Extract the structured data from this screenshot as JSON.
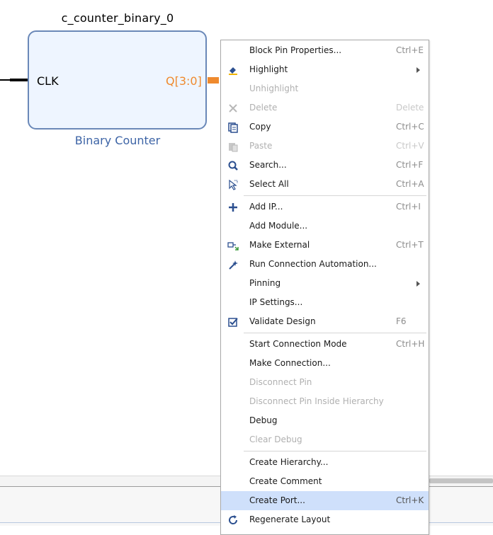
{
  "diagram": {
    "block_name": "c_counter_binary_0",
    "block_type": "Binary Counter",
    "input_pin": "CLK",
    "output_pin": "Q[3:0]",
    "colors": {
      "block_fill": "#eef5ff",
      "block_border": "#6a88b8",
      "output_pin": "#ef8a2e",
      "subtitle": "#3d64a6"
    }
  },
  "context_menu": {
    "items": [
      {
        "label": "Block Pin Properties...",
        "shortcut": "Ctrl+E",
        "icon": "",
        "disabled": false
      },
      {
        "label": "Highlight",
        "shortcut": "",
        "icon": "highlight-icon",
        "disabled": false,
        "submenu": true
      },
      {
        "label": "Unhighlight",
        "shortcut": "",
        "icon": "",
        "disabled": true
      },
      {
        "label": "Delete",
        "shortcut": "Delete",
        "icon": "delete-icon",
        "disabled": true
      },
      {
        "label": "Copy",
        "shortcut": "Ctrl+C",
        "icon": "copy-icon",
        "disabled": false
      },
      {
        "label": "Paste",
        "shortcut": "Ctrl+V",
        "icon": "paste-icon",
        "disabled": true
      },
      {
        "label": "Search...",
        "shortcut": "Ctrl+F",
        "icon": "search-icon",
        "disabled": false
      },
      {
        "label": "Select All",
        "shortcut": "Ctrl+A",
        "icon": "select-all-icon",
        "disabled": false
      },
      {
        "label": "Add IP...",
        "shortcut": "Ctrl+I",
        "icon": "add-icon",
        "disabled": false
      },
      {
        "label": "Add Module...",
        "shortcut": "",
        "icon": "",
        "disabled": false
      },
      {
        "label": "Make External",
        "shortcut": "Ctrl+T",
        "icon": "make-external-icon",
        "disabled": false
      },
      {
        "label": "Run Connection Automation...",
        "shortcut": "",
        "icon": "wand-icon",
        "disabled": false
      },
      {
        "label": "Pinning",
        "shortcut": "",
        "icon": "",
        "disabled": false,
        "submenu": true
      },
      {
        "label": "IP Settings...",
        "shortcut": "",
        "icon": "",
        "disabled": false
      },
      {
        "label": "Validate Design",
        "shortcut": "F6",
        "icon": "validate-icon",
        "disabled": false
      },
      {
        "label": "Start Connection Mode",
        "shortcut": "Ctrl+H",
        "icon": "",
        "disabled": false
      },
      {
        "label": "Make Connection...",
        "shortcut": "",
        "icon": "",
        "disabled": false
      },
      {
        "label": "Disconnect Pin",
        "shortcut": "",
        "icon": "",
        "disabled": true
      },
      {
        "label": "Disconnect Pin Inside Hierarchy",
        "shortcut": "",
        "icon": "",
        "disabled": true
      },
      {
        "label": "Debug",
        "shortcut": "",
        "icon": "",
        "disabled": false
      },
      {
        "label": "Clear Debug",
        "shortcut": "",
        "icon": "",
        "disabled": true
      },
      {
        "label": "Create Hierarchy...",
        "shortcut": "",
        "icon": "",
        "disabled": false
      },
      {
        "label": "Create Comment",
        "shortcut": "",
        "icon": "",
        "disabled": false
      },
      {
        "label": "Create Port...",
        "shortcut": "Ctrl+K",
        "icon": "",
        "disabled": false,
        "selected": true
      },
      {
        "label": "Regenerate Layout",
        "shortcut": "",
        "icon": "regenerate-icon",
        "disabled": false
      }
    ],
    "colors": {
      "selected_bg": "#cfe0fb",
      "disabled_text": "#b0b0b0",
      "shortcut_text": "#8c8c8c"
    }
  }
}
